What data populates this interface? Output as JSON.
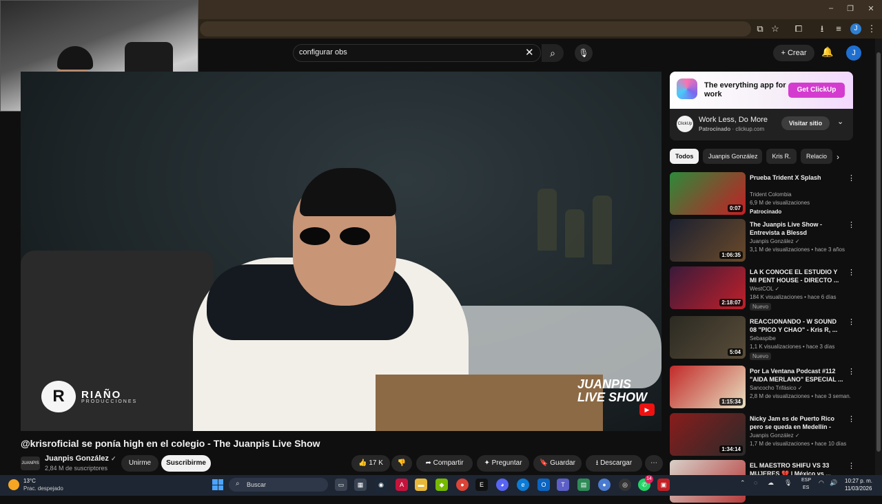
{
  "browser": {
    "window_controls": [
      "–",
      "❐",
      "✕"
    ],
    "profile_initial": "J",
    "toolbar_icons": [
      "install-icon",
      "star-icon",
      "extensions-icon",
      "download-icon",
      "playlist-icon"
    ]
  },
  "youtube": {
    "search": {
      "query": "configurar obs"
    },
    "create_label": "Crear",
    "avatar_initial": "J"
  },
  "video": {
    "title": "@krisroficial se ponía high en el colegio - The Juanpis Live Show",
    "watermark_left": "RIAÑO",
    "watermark_left_sub": "PRODUCCIONES",
    "watermark_right_1": "JUANPIS",
    "watermark_right_2": "LIVE SHOW",
    "channel": {
      "name": "Juanpis González",
      "subscribers": "2,84 M de suscriptores",
      "avatar_text": "JUANPIS"
    },
    "buttons": {
      "join": "Unirme",
      "subscribe": "Suscribirme",
      "likes": "17 K",
      "share": "Compartir",
      "ask": "Preguntar",
      "save": "Guardar",
      "download": "Descargar"
    }
  },
  "ad": {
    "headline": "The everything app for work",
    "cta": "Get ClickUp",
    "avatar_text": "ClickUp",
    "title": "Work Less, Do More",
    "sponsored": "Patrocinado",
    "domain": "clickup.com",
    "visit": "Visitar sitio"
  },
  "chips": [
    "Todos",
    "Juanpis González",
    "Kris R.",
    "Relacio"
  ],
  "recommendations": [
    {
      "title": "Prueba Trident X Splash",
      "channel": "Trident Colombia",
      "meta": "6,9 M de visualizaciones",
      "badge": "Patrocinado",
      "duration": "0:07",
      "thumb": [
        "#2c8a3b",
        "#c41f25"
      ]
    },
    {
      "title": "The Juanpis Live Show - Entrevista a Blessd",
      "channel": "Juanpis González ✓",
      "meta": "3,1 M de visualizaciones • hace 3 años",
      "badge": "",
      "duration": "1:06:35",
      "thumb": [
        "#1b2030",
        "#6b4a2a"
      ]
    },
    {
      "title": "LA K CONOCE EL ESTUDIO Y MI PENT HOUSE - DIRECTO ...",
      "channel": "WestCOL ✓",
      "meta": "184 K visualizaciones • hace 6 días",
      "badge": "Nuevo",
      "duration": "2:18:07",
      "thumb": [
        "#3a1a3a",
        "#c0202a"
      ]
    },
    {
      "title": "REACCIONANDO - W SOUND 08 \"PICO Y CHAO\" - Kris R, ...",
      "channel": "Sebaspibe",
      "meta": "1,1 K visualizaciones • hace 3 días",
      "badge": "Nuevo",
      "duration": "5:04",
      "thumb": [
        "#2b2a22",
        "#5a4d3a"
      ]
    },
    {
      "title": "Por La Ventana Podcast #112 \"AIDA MERLANO\" ESPECIAL ...",
      "channel": "Sancocho Trifásico ✓",
      "meta": "2,8 M de visualizaciones • hace 3 seman...",
      "badge": "",
      "duration": "1:15:34",
      "thumb": [
        "#c22a2a",
        "#e8e0c0"
      ]
    },
    {
      "title": "Nicky Jam es de Puerto Rico pero se queda en Medellín - Th...",
      "channel": "Juanpis González ✓",
      "meta": "1,7 M de visualizaciones • hace 10 días",
      "badge": "",
      "duration": "1:34:14",
      "thumb": [
        "#8a1c1c",
        "#2a2a2a"
      ]
    },
    {
      "title": "EL MAESTRO SHIFU VS 33 MUJERES 💔 | México vs ...",
      "channel": "",
      "meta": "",
      "badge": "",
      "duration": "",
      "thumb": [
        "#d7d0c8",
        "#b63a3a"
      ]
    }
  ],
  "taskbar": {
    "temp": "13°C",
    "weather": "Prac. despejado",
    "search": "Buscar",
    "lang1": "ESP",
    "lang2": "ES",
    "time": "10:27 p. m.",
    "date": "11/03/2026",
    "badge_count": "14"
  }
}
